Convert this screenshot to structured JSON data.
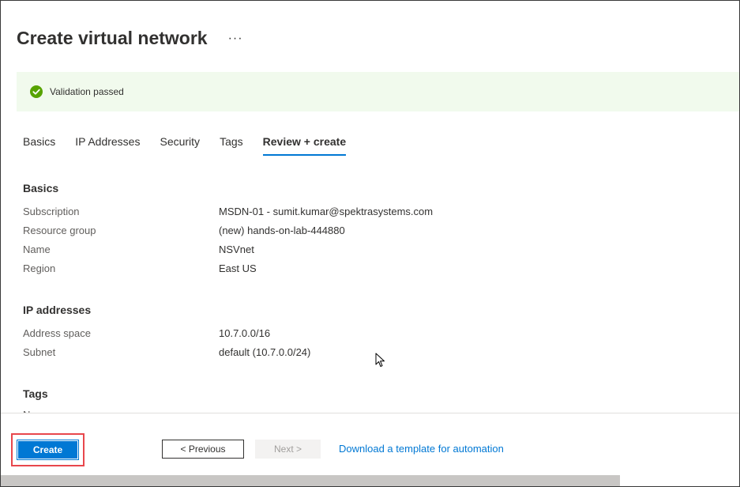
{
  "header": {
    "title": "Create virtual network",
    "more_label": "···"
  },
  "validation": {
    "message": "Validation passed",
    "icon": "check-circle-icon",
    "color": "#57a300"
  },
  "tabs": [
    {
      "label": "Basics",
      "active": false
    },
    {
      "label": "IP Addresses",
      "active": false
    },
    {
      "label": "Security",
      "active": false
    },
    {
      "label": "Tags",
      "active": false
    },
    {
      "label": "Review + create",
      "active": true
    }
  ],
  "sections": {
    "basics": {
      "title": "Basics",
      "fields": [
        {
          "label": "Subscription",
          "value": "MSDN-01 - sumit.kumar@spektrasystems.com"
        },
        {
          "label": "Resource group",
          "value": "(new) hands-on-lab-444880"
        },
        {
          "label": "Name",
          "value": "NSVnet"
        },
        {
          "label": "Region",
          "value": "East US"
        }
      ]
    },
    "ip_addresses": {
      "title": "IP addresses",
      "fields": [
        {
          "label": "Address space",
          "value": "10.7.0.0/16"
        },
        {
          "label": "Subnet",
          "value": "default (10.7.0.0/24)"
        }
      ]
    },
    "tags": {
      "title": "Tags",
      "clipped_label": "Name"
    }
  },
  "footer": {
    "create_label": "Create",
    "previous_label": "< Previous",
    "next_label": "Next >",
    "template_link": "Download a template for automation"
  },
  "colors": {
    "accent": "#0078d4",
    "highlight": "#e8474c",
    "validation_bg": "#f1faed"
  }
}
